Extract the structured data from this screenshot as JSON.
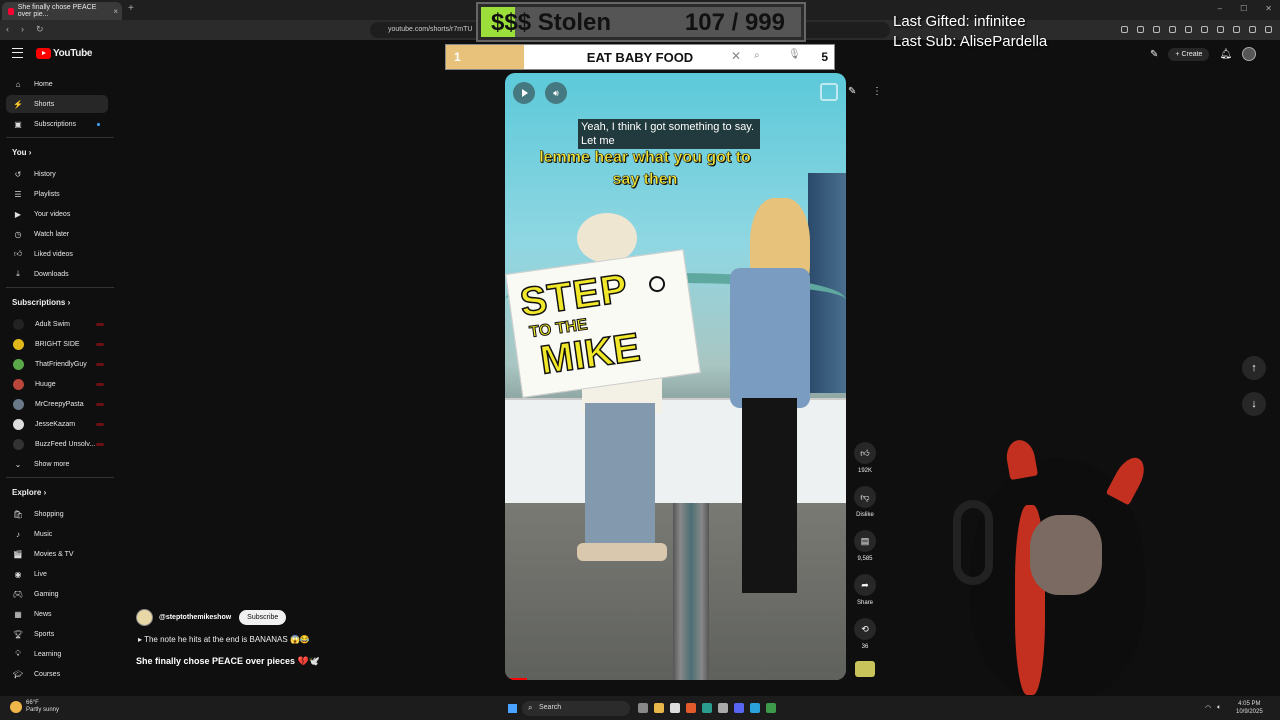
{
  "browser": {
    "tab_title": "She finally chose PEACE over pie...",
    "url": "youtube.com/shorts/r7mTU"
  },
  "overlay": {
    "stolen_label": "$$$ Stolen",
    "stolen_count": "107 / 999",
    "stolen_fraction": 0.107,
    "last_gifted": "Last Gifted: infinitee",
    "last_sub": "Last Sub: AlisePardella",
    "goal_left": "1",
    "goal_text": "EAT BABY FOOD",
    "goal_right": "5",
    "goal_fraction": 0.2
  },
  "youtube": {
    "logo_text": "YouTube",
    "create_label": "Create"
  },
  "sidebar": {
    "main": [
      {
        "label": "Home",
        "icon": "home-icon"
      },
      {
        "label": "Shorts",
        "icon": "shorts-icon",
        "active": true
      },
      {
        "label": "Subscriptions",
        "icon": "subscriptions-icon"
      }
    ],
    "you_label": "You",
    "you_items": [
      {
        "label": "History",
        "icon": "history-icon"
      },
      {
        "label": "Playlists",
        "icon": "playlists-icon"
      },
      {
        "label": "Your videos",
        "icon": "your-videos-icon"
      },
      {
        "label": "Watch later",
        "icon": "watch-later-icon"
      },
      {
        "label": "Liked videos",
        "icon": "liked-videos-icon"
      },
      {
        "label": "Downloads",
        "icon": "downloads-icon"
      }
    ],
    "subscriptions_label": "Subscriptions",
    "subscriptions": [
      {
        "label": "Adult Swim",
        "color": "#222222"
      },
      {
        "label": "BRIGHT SIDE",
        "color": "#e0b81c"
      },
      {
        "label": "ThatFriendlyGuy",
        "color": "#5aa84a"
      },
      {
        "label": "Huuge",
        "color": "#b8463a"
      },
      {
        "label": "MrCreepyPasta",
        "color": "#6a7a8a"
      },
      {
        "label": "JesseKazam",
        "color": "#dddddd"
      },
      {
        "label": "BuzzFeed Unsolv...",
        "color": "#333333"
      }
    ],
    "show_more": "Show more",
    "explore_label": "Explore",
    "explore": [
      {
        "label": "Shopping",
        "icon": "shopping-icon"
      },
      {
        "label": "Music",
        "icon": "music-icon"
      },
      {
        "label": "Movies & TV",
        "icon": "movies-icon"
      },
      {
        "label": "Live",
        "icon": "live-icon"
      },
      {
        "label": "Gaming",
        "icon": "gaming-icon"
      },
      {
        "label": "News",
        "icon": "news-icon"
      },
      {
        "label": "Sports",
        "icon": "sports-icon"
      },
      {
        "label": "Learning",
        "icon": "learning-icon"
      },
      {
        "label": "Courses",
        "icon": "courses-icon"
      }
    ]
  },
  "video": {
    "caption_top": "Yeah, I think I got something to say. Let me",
    "caption_main": "lemme hear what you got to say then",
    "sign_line1": "STEP",
    "sign_line2": "TO THE",
    "sign_line3": "MIKE"
  },
  "meta": {
    "channel": "@steptothemikeshow",
    "subscribe": "Subscribe",
    "music_line": "The note he hits at the end is BANANAS 😱😂",
    "title": "She finally chose PEACE over pieces 💔🕊️"
  },
  "actions": {
    "likes": "192K",
    "dislike": "Dislike",
    "comments": "9,585",
    "share": "Share",
    "remix": "36"
  },
  "taskbar": {
    "temp": "66°F",
    "weather": "Partly sunny",
    "search": "Search",
    "time": "4:05 PM",
    "date": "10/9/2025"
  }
}
